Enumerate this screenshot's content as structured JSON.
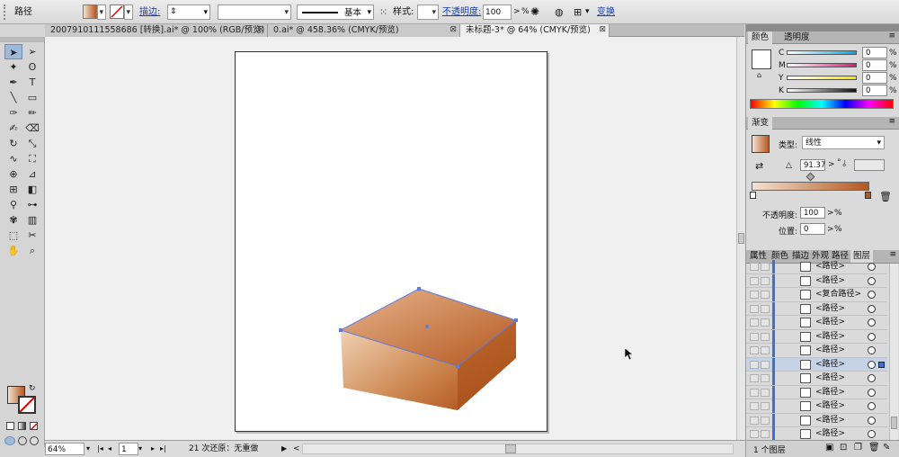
{
  "control_bar": {
    "object_type": "路径",
    "stroke_label": "描边:",
    "stroke_profile": "基本",
    "style_label": "样式:",
    "opacity_label": "不透明度:",
    "opacity_value": "100",
    "opacity_unit": "%",
    "transform_label": "变换"
  },
  "tabs": [
    {
      "label": "2007910111558686 [转换].ai* @ 100% (RGB/预览)"
    },
    {
      "label": "0.ai* @ 458.36% (CMYK/预览)"
    },
    {
      "label": "未标题-3* @ 64% (CMYK/预览)"
    }
  ],
  "status_bar": {
    "zoom": "64%",
    "page": "1",
    "undo_status": "21 次还原：无重做"
  },
  "color_panel": {
    "tabs": [
      "颜色",
      "透明度"
    ],
    "channels": [
      {
        "label": "C",
        "value": "0"
      },
      {
        "label": "M",
        "value": "0"
      },
      {
        "label": "Y",
        "value": "0"
      },
      {
        "label": "K",
        "value": "0"
      }
    ]
  },
  "gradient_panel": {
    "tab": "渐变",
    "type_label": "类型:",
    "type_value": "线性",
    "angle_value": "91.37",
    "opacity_label": "不透明度:",
    "opacity_value": "100",
    "location_label": "位置:",
    "location_value": "0",
    "unit": "%",
    "start_color": "#f3e2d1",
    "end_color": "#b4571f"
  },
  "layers_panel": {
    "tabs": [
      "属性",
      "颜色",
      "描边",
      "外观",
      "路径",
      "图层"
    ],
    "rows": [
      {
        "name": "<路径>",
        "selected": false
      },
      {
        "name": "<路径>",
        "selected": false
      },
      {
        "name": "<复合路径>",
        "selected": false
      },
      {
        "name": "<路径>",
        "selected": false
      },
      {
        "name": "<路径>",
        "selected": false
      },
      {
        "name": "<路径>",
        "selected": false
      },
      {
        "name": "<路径>",
        "selected": false
      },
      {
        "name": "<路径>",
        "selected": true
      },
      {
        "name": "<路径>",
        "selected": false
      },
      {
        "name": "<路径>",
        "selected": false
      },
      {
        "name": "<路径>",
        "selected": false
      },
      {
        "name": "<路径>",
        "selected": false
      },
      {
        "name": "<路径>",
        "selected": false
      }
    ],
    "footer": "1 个图层"
  },
  "tools": [
    "selection-tool",
    "direct-selection-tool",
    "magic-wand-tool",
    "lasso-tool",
    "pen-tool",
    "type-tool",
    "line-tool",
    "rectangle-tool",
    "paintbrush-tool",
    "pencil-tool",
    "blob-brush-tool",
    "eraser-tool",
    "rotate-tool",
    "scale-tool",
    "warp-tool",
    "free-transform-tool",
    "shape-builder-tool",
    "perspective-grid-tool",
    "mesh-tool",
    "gradient-tool",
    "eyedropper-tool",
    "blend-tool",
    "symbol-sprayer-tool",
    "column-graph-tool",
    "artboard-tool",
    "slice-tool",
    "hand-tool",
    "zoom-tool"
  ]
}
